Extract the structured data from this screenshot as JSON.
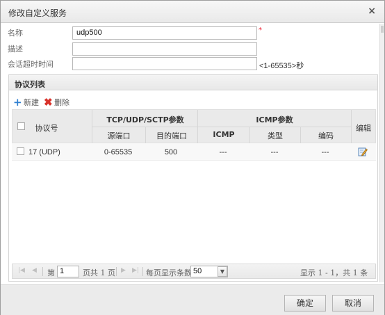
{
  "dialog": {
    "title": "修改自定义服务",
    "close_glyph": "×"
  },
  "form": {
    "name_label": "名称",
    "name_value": "udp500",
    "required_mark": "*",
    "desc_label": "描述",
    "desc_value": "",
    "timeout_label": "会话超时时间",
    "timeout_value": "",
    "timeout_hint": "<1-65535>秒"
  },
  "protocol_panel": {
    "title": "协议列表",
    "toolbar": {
      "add_label": "新建",
      "delete_label": "删除"
    },
    "table": {
      "headers": {
        "protocol": "协议号",
        "tcp_group": "TCP/UDP/SCTP参数",
        "icmp_group": "ICMP参数",
        "src_port": "源端口",
        "dst_port": "目的端口",
        "icmp": "ICMP",
        "type": "类型",
        "code": "编码",
        "edit": "编辑"
      },
      "rows": [
        {
          "protocol": "17 (UDP)",
          "src_port": "0-65535",
          "dst_port": "500",
          "icmp": "---",
          "type": "---",
          "code": "---"
        }
      ]
    },
    "pager": {
      "first": "|◀",
      "prev": "◀",
      "page_prefix": "第",
      "page_value": "1",
      "page_suffix": "页共 1 页",
      "next": "▶",
      "last": "▶|",
      "per_page_label": "每页显示条数",
      "per_page_value": "50",
      "summary": "显示 1 - 1，共 1 条"
    }
  },
  "footer": {
    "ok_label": "确定",
    "cancel_label": "取消"
  },
  "colors": {
    "add_icon": "#2f7fd0",
    "delete_icon": "#d8312a",
    "required": "#ee2233"
  }
}
